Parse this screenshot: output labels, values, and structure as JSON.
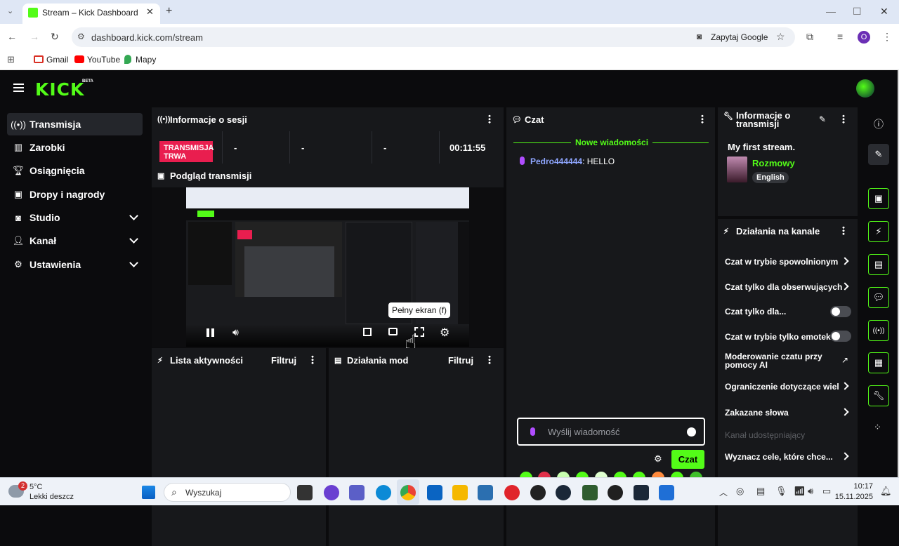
{
  "browser": {
    "tab_title": "Stream – Kick Dashboard",
    "url": "dashboard.kick.com/stream",
    "ask_google": "Zapytaj Google",
    "profile_initial": "O",
    "bookmarks": [
      "Gmail",
      "YouTube",
      "Mapy"
    ]
  },
  "header": {
    "logo": "KICK",
    "beta": "BETA"
  },
  "sidebar": {
    "items": [
      {
        "label": "Transmisja",
        "icon": "broadcast-icon"
      },
      {
        "label": "Zarobki",
        "icon": "chart-icon"
      },
      {
        "label": "Osiągnięcia",
        "icon": "trophy-icon"
      },
      {
        "label": "Dropy i nagrody",
        "icon": "gift-icon"
      },
      {
        "label": "Studio",
        "icon": "studio-icon"
      },
      {
        "label": "Kanał",
        "icon": "users-icon"
      },
      {
        "label": "Ustawienia",
        "icon": "gear-icon"
      }
    ]
  },
  "session": {
    "title": "Informacje o sesji",
    "live_badge": "TRANSMISJA TRWA",
    "stats": [
      "-",
      "-",
      "-"
    ],
    "timer": "00:11:55"
  },
  "preview": {
    "title": "Podgląd transmisji",
    "tooltip": "Pełny ekran (f)"
  },
  "activity": {
    "title": "Lista aktywności",
    "filter": "Filtruj"
  },
  "modactions": {
    "title": "Działania mod",
    "filter": "Filtruj"
  },
  "chat": {
    "title": "Czat",
    "new_messages": "Nowe wiadomości",
    "messages": [
      {
        "user": "Pedro444444",
        "text": ": HELLO"
      }
    ],
    "input_placeholder": "Wyślij wiadomość",
    "send_label": "Czat"
  },
  "stream_info": {
    "title": "Informacje o transmisji",
    "stream_title": "My first stream.",
    "category": "Rozmowy",
    "language": "English"
  },
  "channel_actions": {
    "title": "Działania na kanale",
    "items": [
      {
        "label": "Czat w trybie spowolnionym",
        "control": "arrow"
      },
      {
        "label": "Czat tylko dla obserwujących",
        "control": "arrow"
      },
      {
        "label": "Czat tylko dla...",
        "control": "toggle"
      },
      {
        "label": "Czat w trybie tylko emotek",
        "control": "toggle"
      },
      {
        "label": "Moderowanie czatu przy pomocy AI",
        "control": "external"
      },
      {
        "label": "Ograniczenie dotyczące wiel",
        "control": "arrow"
      },
      {
        "label": "Zakazane słowa",
        "control": "arrow"
      },
      {
        "label": "Kanał udostępniający",
        "control": "disabled"
      },
      {
        "label": "Wyznacz cele, które chce...",
        "control": "arrow"
      }
    ]
  },
  "taskbar": {
    "temp": "5°C",
    "weather": "Lekki deszcz",
    "badge": "2",
    "search": "Wyszukaj",
    "time": "10:17",
    "date": "15.11.2025"
  },
  "colors": {
    "accent": "#53fc18",
    "live": "#e91e4f",
    "panel": "#17181b",
    "username": "#8fa6ff"
  }
}
